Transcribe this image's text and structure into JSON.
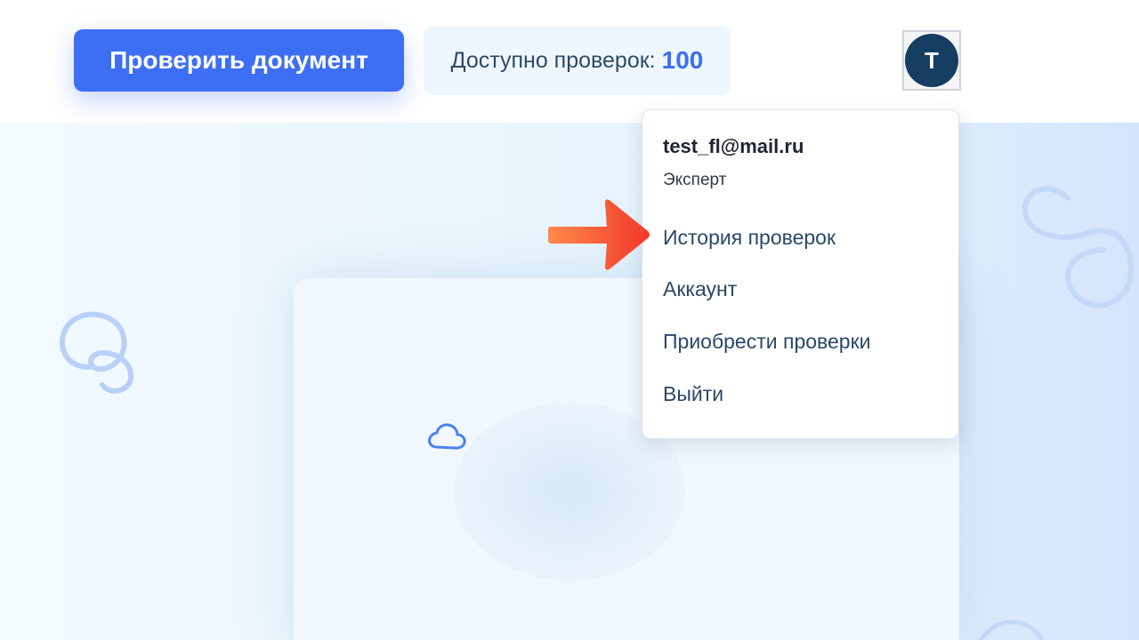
{
  "header": {
    "check_button_label": "Проверить документ",
    "credits_label": "Доступно проверок:",
    "credits_count": "100",
    "avatar_initial": "T"
  },
  "user_menu": {
    "email": "test_fl@mail.ru",
    "role": "Эксперт",
    "items": [
      {
        "label": "История проверок"
      },
      {
        "label": "Аккаунт"
      },
      {
        "label": "Приобрести проверки"
      },
      {
        "label": "Выйти"
      }
    ]
  },
  "annotation": {
    "arrow_icon": "right-arrow-pointer",
    "arrow_color": "#f4452f"
  },
  "colors": {
    "primary": "#3d6ff5",
    "avatar_bg": "#153e62",
    "credits_bg": "#eef7fd",
    "menu_text": "#2a4868"
  }
}
